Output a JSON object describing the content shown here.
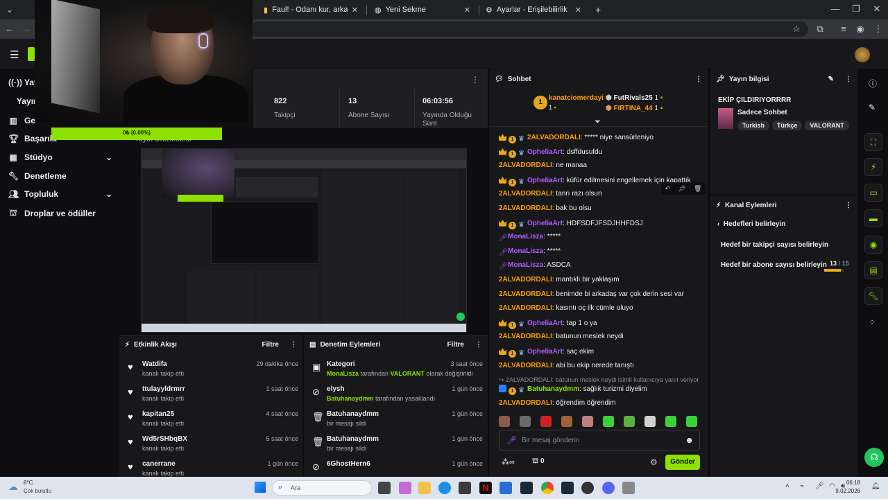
{
  "browser": {
    "tabs": [
      {
        "title": "Faul! - Odanı kur, arkadaşlarını"
      },
      {
        "title": "Yeni Sekme"
      },
      {
        "title": "Ayarlar - Erişilebilirlik"
      }
    ],
    "new_tab": "+"
  },
  "sidebar": {
    "items": [
      {
        "label": "Yay",
        "icon": "broadcast-icon"
      },
      {
        "label": "Yayın",
        "icon": ""
      },
      {
        "label": "Ge",
        "icon": "analytics-icon"
      },
      {
        "label": "Başarıla",
        "icon": "trophy-icon"
      },
      {
        "label": "Stüdyo",
        "icon": "grid-icon"
      },
      {
        "label": "Denetleme",
        "icon": "wrench-icon"
      },
      {
        "label": "Topluluk",
        "icon": "people-icon"
      },
      {
        "label": "Droplar ve ödüller",
        "icon": "gift-icon"
      }
    ]
  },
  "webcam": {
    "progress_text": "0₺ (0.00%)"
  },
  "stats": {
    "followers": {
      "value": "822",
      "label": "Takipçi"
    },
    "subs": {
      "value": "13",
      "label": "Abone Sayısı"
    },
    "uptime": {
      "value": "06:03:56",
      "label": "Yayında Olduğu Süre"
    }
  },
  "preview_label": "Yayın Önizlemesi",
  "activity_feed": {
    "title": "Etkinlik Akışı",
    "filter": "Filtre",
    "items": [
      {
        "name": "Watdifa",
        "sub": "kanalı takip etti",
        "time": "29 dakika önce"
      },
      {
        "name": "ttulayyldrmrr",
        "sub": "kanalı takip etti",
        "time": "1 saat önce"
      },
      {
        "name": "kapitan25",
        "sub": "kanalı takip etti",
        "time": "4 saat önce"
      },
      {
        "name": "Wd5rSHbqBX",
        "sub": "kanalı takip etti",
        "time": "5 saat önce"
      },
      {
        "name": "canerrane",
        "sub": "kanalı takip etti",
        "time": "1 gün önce"
      }
    ]
  },
  "mod_actions": {
    "title": "Denetim Eylemleri",
    "filter": "Filtre",
    "items": [
      {
        "name": "Kategori",
        "sub_user": "MonaLisza",
        "sub_mid": " tarafından ",
        "sub_hl": "VALORANT",
        "sub_end": " olarak değiştirildi",
        "time": "3 saat önce",
        "icon": "category-icon"
      },
      {
        "name": "elysh",
        "sub_user": "Batuhanaydmm",
        "sub_mid": " tarafından yasaklandı",
        "sub_hl": "",
        "sub_end": "",
        "time": "1 gün önce",
        "icon": "ban-icon"
      },
      {
        "name": "Batuhanaydmm",
        "sub_user": "",
        "sub_mid": "bir mesajı sildi",
        "sub_hl": "",
        "sub_end": "",
        "time": "1 gün önce",
        "icon": "trash-icon"
      },
      {
        "name": "Batuhanaydmm",
        "sub_user": "",
        "sub_mid": "bir mesajı sildi",
        "sub_hl": "",
        "sub_end": "",
        "time": "1 gün önce",
        "icon": "trash-icon"
      },
      {
        "name": "6GhostHern6",
        "sub_user": "",
        "sub_mid": "",
        "sub_hl": "",
        "sub_end": "",
        "time": "1 gün önce",
        "icon": "ban-icon"
      }
    ]
  },
  "chat": {
    "title": "Sohbet",
    "leaderboard": [
      {
        "rank": "1",
        "name": "kanatciomerdayi",
        "count": "1"
      },
      {
        "name": "FutRivals25",
        "count": "1"
      },
      {
        "name": "FIRTINA_44",
        "count": "1"
      }
    ],
    "messages": [
      {
        "user": "2ALVADORDALI",
        "text": ": ***** niye sansürleniyo",
        "badges": [
          "crown",
          "one",
          "vip"
        ],
        "color": "o"
      },
      {
        "user": "OpheliaArt",
        "text": ": dsffdusufdu",
        "badges": [
          "crown",
          "one",
          "vip"
        ],
        "color": "p"
      },
      {
        "user": "2ALVADORDALI",
        "text": ": ne manaa",
        "badges": [],
        "color": "o"
      },
      {
        "user": "OpheliaArt",
        "text": ": küfür edilmesini engellemek için kapattık",
        "badges": [
          "crown",
          "one",
          "vip"
        ],
        "color": "p"
      },
      {
        "user": "2ALVADORDALI",
        "text": ": tanrı razı olsun",
        "badges": [],
        "color": "o"
      },
      {
        "user": "2ALVADORDALI",
        "text": ": bak bu olsu",
        "badges": [],
        "color": "o"
      },
      {
        "user": "OpheliaArt",
        "text": ": HDFSDFJFSDJHHFDSJ",
        "badges": [
          "crown",
          "one",
          "vip"
        ],
        "color": "p"
      },
      {
        "user": "MonaLisza",
        "text": ": *****",
        "badges": [
          "mic"
        ],
        "color": "p"
      },
      {
        "user": "MonaLisza",
        "text": ": *****",
        "badges": [
          "mic"
        ],
        "color": "p"
      },
      {
        "user": "MonaLisza",
        "text": ": ASDCA",
        "badges": [
          "mic"
        ],
        "color": "p"
      },
      {
        "user": "2ALVADORDALI",
        "text": ": mantıklı bir yaklaşım",
        "badges": [],
        "color": "o"
      },
      {
        "user": "2ALVADORDALI",
        "text": ": benimde bi arkadaş var çok derin sesi var",
        "badges": [],
        "color": "o"
      },
      {
        "user": "2ALVADORDALI",
        "text": ": kasıntı oç ilk cümle oluyo",
        "badges": [],
        "color": "o"
      },
      {
        "user": "OpheliaArt",
        "text": ": tap 1 o ya",
        "badges": [
          "crown",
          "one",
          "vip"
        ],
        "color": "p"
      },
      {
        "user": "2ALVADORDALI",
        "text": ": batunun meslek neydi",
        "badges": [],
        "color": "o"
      },
      {
        "user": "OpheliaArt",
        "text": ": saç ekim",
        "badges": [
          "crown",
          "one",
          "vip"
        ],
        "color": "p"
      },
      {
        "user": "2ALVADORDALI",
        "text": ": abi bu ekip nerede tanıştı",
        "badges": [],
        "color": "o"
      }
    ],
    "reply_context": "2ALVADORDALI: batunun meslek neydi isimli kullanıcıya yanıt veriyor",
    "reply_msg": {
      "user": "Batuhanaydmm",
      "text": ": sağlık turizmi diyelim"
    },
    "last_msg": {
      "user": "2ALVADORDALI",
      "text": ": öğrendim öğrendim"
    },
    "input_placeholder": "Bir mesaj gönderin",
    "points": "0",
    "send": "Gönder"
  },
  "stream_info": {
    "title": "Yayın bilgisi",
    "stream_title": "EKİP ÇILDIRIYORRRR",
    "chat_mode": "Sadece Sohbet",
    "tags": [
      "Turkish",
      "Türkçe",
      "VALORANT"
    ]
  },
  "channel_actions": {
    "title": "Kanal Eylemleri",
    "back": "Hedefleri belirleyin",
    "items": [
      {
        "label": "Hedef bir takipçi sayısı belirleyin"
      },
      {
        "label": "Hedef bir abone sayısı belirleyin",
        "current": "13",
        "target": "15"
      }
    ]
  },
  "taskbar": {
    "weather_temp": "8°C",
    "weather_desc": "Çok bulutlu",
    "search": "Ara",
    "time": "06:18",
    "date": "9.02.2026"
  },
  "colors": {
    "accent": "#8ee000",
    "chat_orange": "#ff9f0a",
    "chat_purple": "#b15cff"
  }
}
